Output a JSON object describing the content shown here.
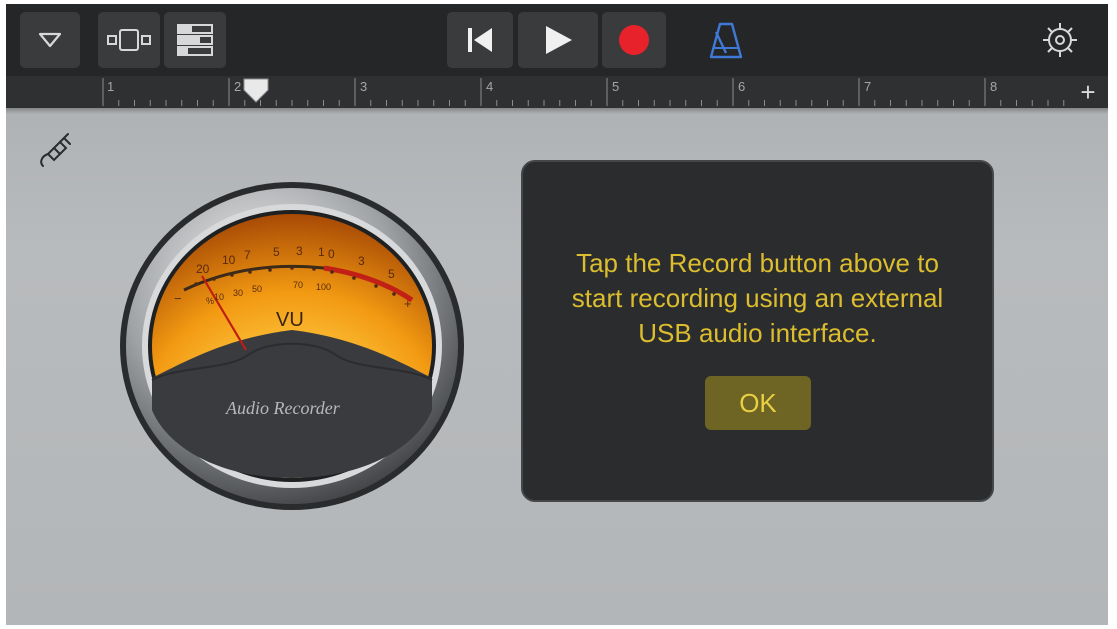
{
  "toolbar": {
    "buttons": [
      {
        "name": "browser-dropdown-button",
        "icon": "triangle-down-icon"
      },
      {
        "name": "track-view-button",
        "icon": "tracks-view-icon"
      },
      {
        "name": "mixer-button",
        "icon": "controls-icon"
      },
      {
        "name": "go-to-beginning-button",
        "icon": "skip-back-icon"
      },
      {
        "name": "play-button",
        "icon": "play-icon"
      },
      {
        "name": "record-button",
        "icon": "record-icon"
      },
      {
        "name": "metronome-button",
        "icon": "metronome-icon"
      },
      {
        "name": "settings-button",
        "icon": "gear-icon"
      }
    ],
    "record_color": "#e8222a",
    "metronome_color": "#3f79d6"
  },
  "ruler": {
    "bars": [
      "1",
      "2",
      "3",
      "4",
      "5",
      "6",
      "7",
      "8"
    ],
    "add_label": "+",
    "playhead_bar": 2
  },
  "vu_meter": {
    "label": "VU",
    "brand": "Audio Recorder",
    "scale_top": [
      "20",
      "10",
      "7",
      "5",
      "3",
      "1",
      "0",
      "3",
      "5"
    ],
    "scale_bottom": [
      "%",
      "10",
      "30",
      "50",
      "70",
      "100"
    ],
    "minus": "−",
    "plus": "+"
  },
  "dialog": {
    "line1": "Tap the Record button above to",
    "line2": "start recording using an external",
    "line3": "USB audio interface.",
    "ok_label": "OK"
  }
}
